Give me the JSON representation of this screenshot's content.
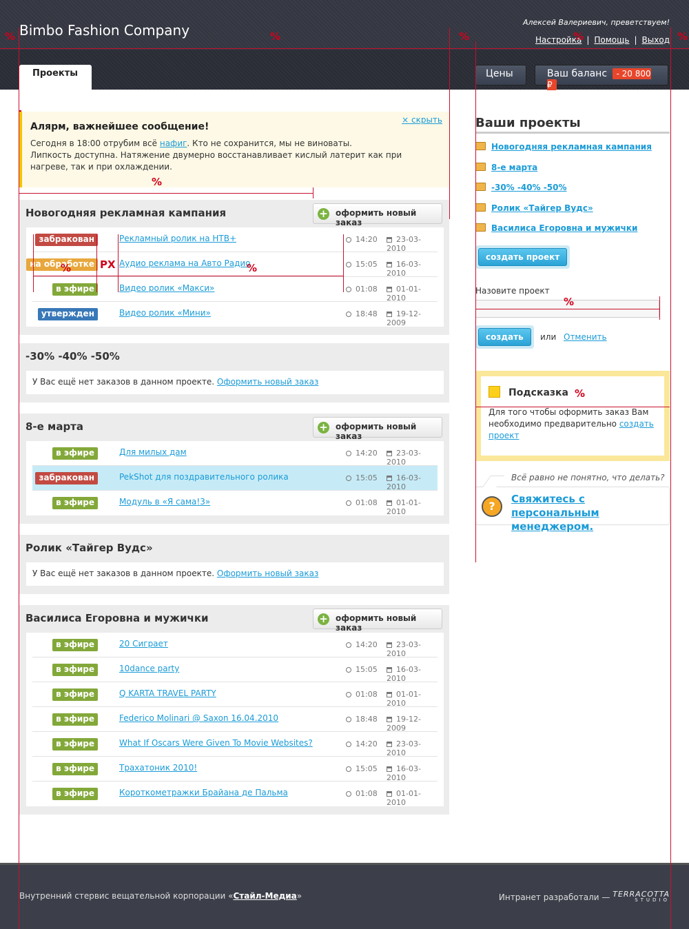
{
  "header": {
    "brand": "Bimbo Fashion Company",
    "greeting": "Алексей Валериевич, преветствуем!",
    "links": [
      "Настройка",
      "Помощь",
      "Выход"
    ],
    "separator": "|",
    "tab_projects": "Проекты",
    "btn_prices": "Цены",
    "btn_balance": "Ваш баланс",
    "balance_value": "- 20 800 ₽"
  },
  "alert": {
    "title": "Алярм, важнейшее сообщение!",
    "text_before": "Сегодня в 18:00 отрубим всё ",
    "link": "нафиг",
    "text_after": ". Кто не сохранится, мы не виноваты.",
    "text2": "Липкость доступна. Натяжение двумерно восстанавливает кислый латерит как при нагреве, так и при охлаждении.",
    "hide": "× скрыть"
  },
  "order_button": "оформить новый заказ",
  "empty_text": "У Вас ещё нет заказов в данном проекте.",
  "empty_link": "Оформить новый заказ",
  "projects": [
    {
      "title": "Новогодняя рекламная кампания",
      "rows": [
        {
          "status": "забракован",
          "color": "#c24a42",
          "title": "Рекламный ролик на НТВ+",
          "time": "14:20",
          "date": "23-03-2010"
        },
        {
          "status": "на обработке",
          "color": "#e8a73d",
          "title": "Аудио реклама на Авто Радио",
          "time": "15:05",
          "date": "16-03-2010"
        },
        {
          "status": "в эфире",
          "color": "#83a83a",
          "title": "Видео ролик «Макси»",
          "time": "01:08",
          "date": "01-01-2010"
        },
        {
          "status": "утвержден",
          "color": "#3878b8",
          "title": "Видео ролик «Мини»",
          "time": "18:48",
          "date": "19-12-2009"
        }
      ]
    },
    {
      "title": "-30% -40% -50%",
      "rows": []
    },
    {
      "title": "8-е марта",
      "rows": [
        {
          "status": "в эфире",
          "color": "#83a83a",
          "title": "Для милых дам",
          "time": "14:20",
          "date": "23-03-2010"
        },
        {
          "status": "забракован",
          "color": "#c24a42",
          "title": "PekShot для поздравительного ролика",
          "time": "15:05",
          "date": "16-03-2010"
        },
        {
          "status": "в эфире",
          "color": "#83a83a",
          "title": "Модуль в «Я сама!3»",
          "time": "01:08",
          "date": "01-01-2010"
        }
      ]
    },
    {
      "title": "Ролик «Тайгер Вудс»",
      "rows": []
    },
    {
      "title": "Василиса Егоровна и мужички",
      "rows": [
        {
          "status": "в эфире",
          "color": "#83a83a",
          "title": "20 Сиграет",
          "time": "14:20",
          "date": "23-03-2010"
        },
        {
          "status": "в эфире",
          "color": "#83a83a",
          "title": "10dance party",
          "time": "15:05",
          "date": "16-03-2010"
        },
        {
          "status": "в эфире",
          "color": "#83a83a",
          "title": "Q KARTA TRAVEL PARTY",
          "time": "01:08",
          "date": "01-01-2010"
        },
        {
          "status": "в эфире",
          "color": "#83a83a",
          "title": "Federico Molinari @ Saxon 16.04.2010",
          "time": "18:48",
          "date": "19-12-2009"
        },
        {
          "status": "в эфире",
          "color": "#83a83a",
          "title": "What If Oscars Were Given To Movie Websites?",
          "time": "14:20",
          "date": "23-03-2010"
        },
        {
          "status": "в эфире",
          "color": "#83a83a",
          "title": "Трахатоник 2010!",
          "time": "15:05",
          "date": "16-03-2010"
        },
        {
          "status": "в эфире",
          "color": "#83a83a",
          "title": "Короткометражки Брайана де Пальма",
          "time": "01:08",
          "date": "01-01-2010"
        }
      ]
    }
  ],
  "sidebar": {
    "title": "Ваши проекты",
    "items": [
      "Новогодняя рекламная кампания",
      "8-е марта",
      "-30% -40% -50%",
      "Ролик «Тайгер Вудс»",
      "Василиса Егоровна и мужички"
    ],
    "create_project_btn": "создать проект",
    "name_label": "Назовите проект",
    "create_btn": "создать",
    "or": "или",
    "cancel": "Отменить",
    "hint_title": "Подсказка",
    "hint_text": "Для того чтобы оформить заказ Вам необходимо предварительно ",
    "hint_link": "создать проект",
    "question": "Всё равно не понятно, что делать?",
    "contact": "Свяжитесь с персональным менеджером."
  },
  "footer": {
    "left_text": "Внутренний стервис вещательной корпорации «",
    "left_link": "Стайл-Медиа",
    "left_end": "»",
    "right_text": "Интранет разработали — ",
    "studio": "TERRACOTTA",
    "studio_sub": "STUDIO"
  },
  "annotations": {
    "percent": "%",
    "px": "PX"
  }
}
